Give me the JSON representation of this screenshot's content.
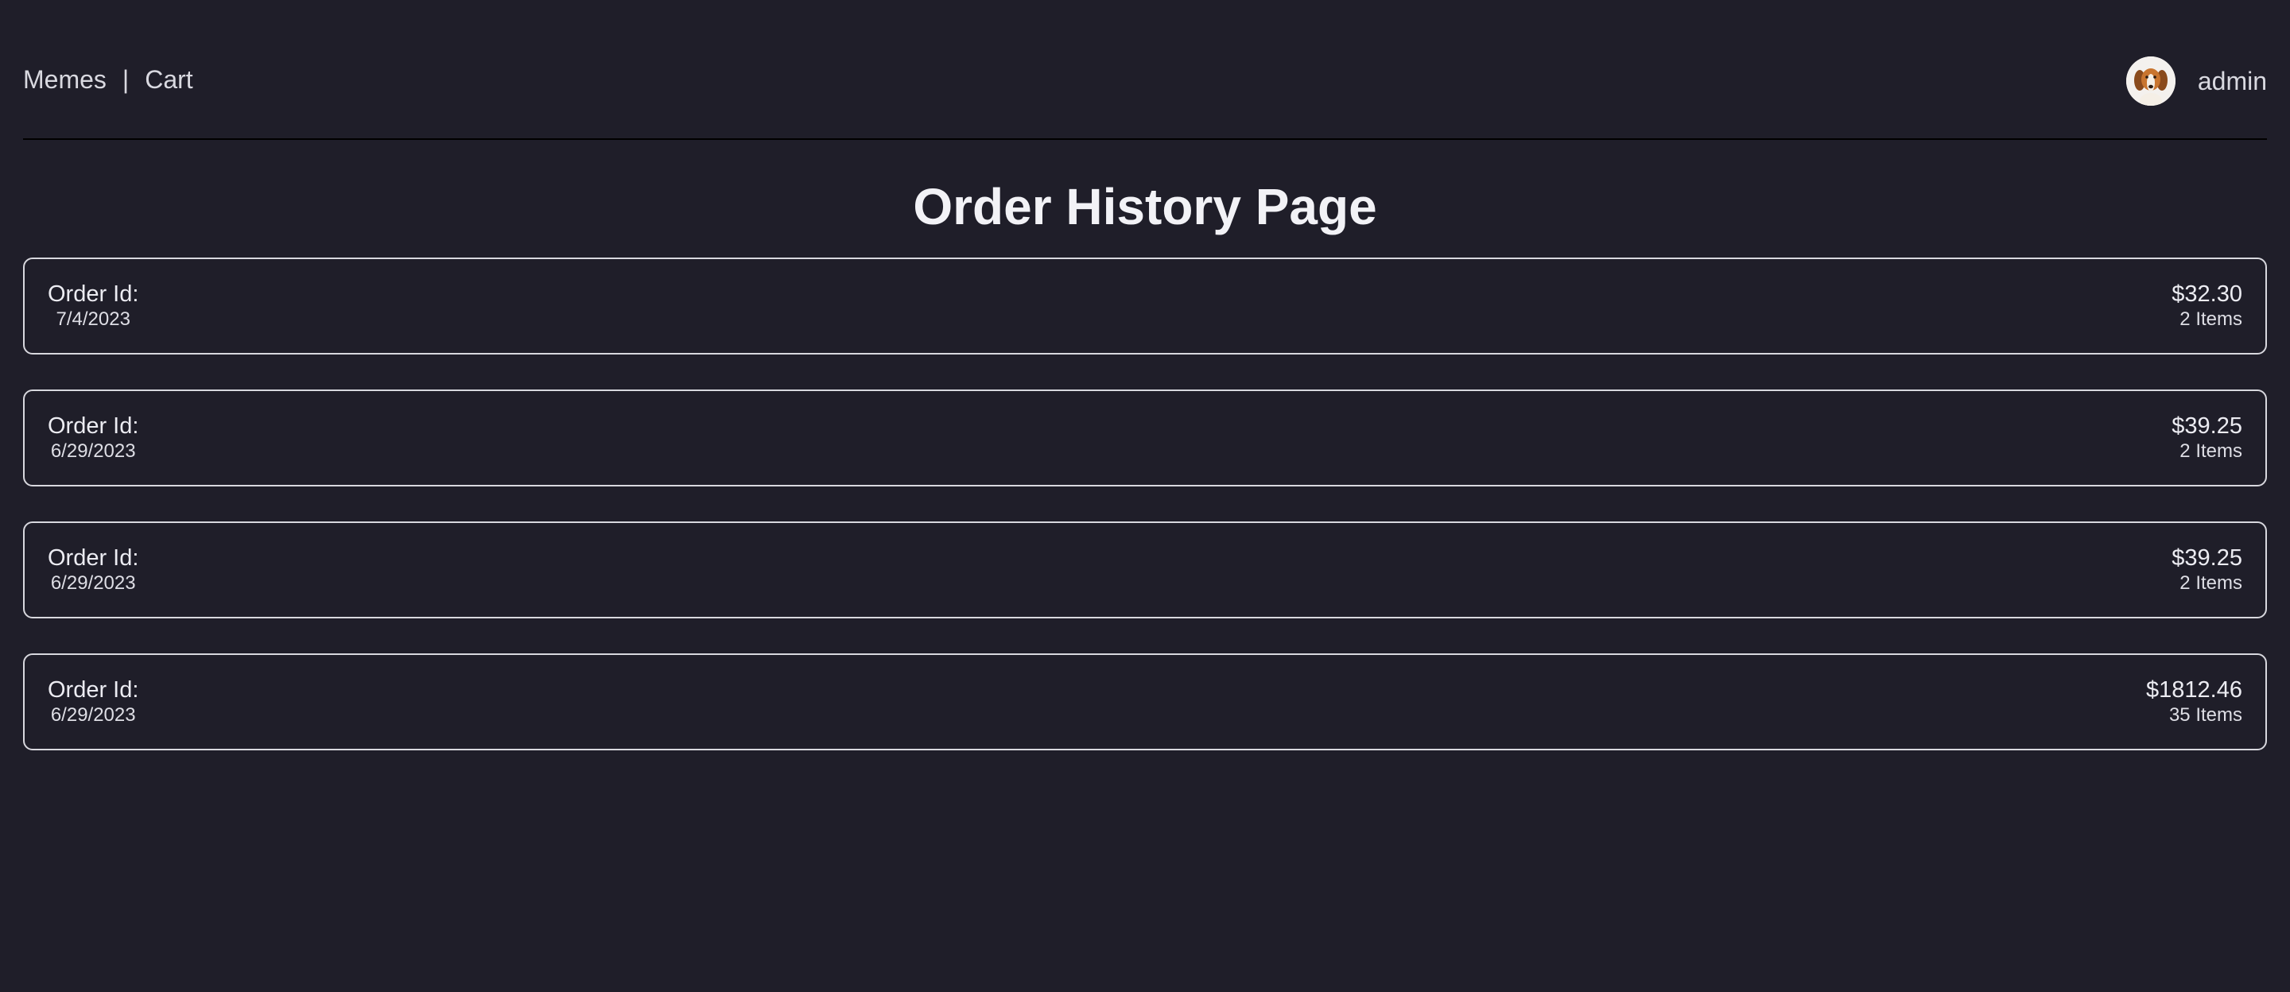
{
  "nav": {
    "links": [
      "Memes",
      "Cart"
    ],
    "separator": "|"
  },
  "user": {
    "name": "admin",
    "avatar_icon": "dog-avatar-icon"
  },
  "page": {
    "title": "Order History Page"
  },
  "orders": [
    {
      "label": "Order Id:",
      "date": "7/4/2023",
      "price": "$32.30",
      "items": "2 Items"
    },
    {
      "label": "Order Id:",
      "date": "6/29/2023",
      "price": "$39.25",
      "items": "2 Items"
    },
    {
      "label": "Order Id:",
      "date": "6/29/2023",
      "price": "$39.25",
      "items": "2 Items"
    },
    {
      "label": "Order Id:",
      "date": "6/29/2023",
      "price": "$1812.46",
      "items": "35 Items"
    }
  ],
  "colors": {
    "background": "#1f1e29",
    "text": "#e8e8ee",
    "card_border": "#d8d8de",
    "divider": "#000000"
  }
}
